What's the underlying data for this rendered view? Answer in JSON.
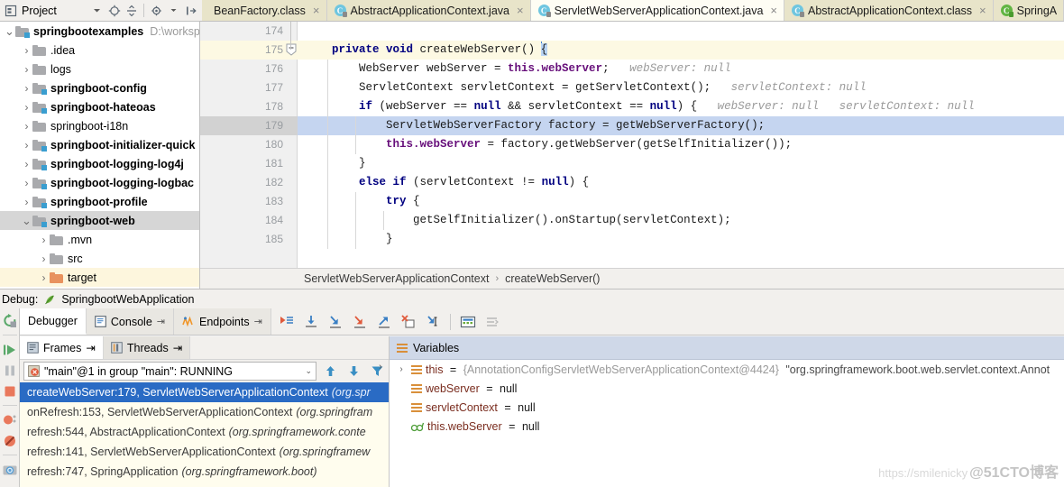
{
  "topbar": {
    "project_label": "Project",
    "icons": [
      "project-dropdown-icon",
      "locate-icon",
      "collapse-all-icon",
      "settings-gear-icon",
      "hide-icon"
    ],
    "tabs": [
      {
        "name": "BeanFactory.class",
        "icon": "class-file-icon",
        "style": "khaki",
        "close": "×"
      },
      {
        "name": "AbstractApplicationContext.java",
        "icon": "java-file-icon",
        "style": "khaki",
        "close": "×"
      },
      {
        "name": "ServletWebServerApplicationContext.java",
        "icon": "java-file-icon",
        "style": "active",
        "close": "×"
      },
      {
        "name": "AbstractApplicationContext.class",
        "icon": "class-file-icon",
        "style": "khaki",
        "close": "×"
      },
      {
        "name": "SpringA",
        "icon": "spring-file-icon",
        "style": "khaki",
        "close": ""
      }
    ]
  },
  "project_tree": [
    {
      "label": "springbootexamples",
      "path": "D:\\worksp",
      "bold": true,
      "indent": 0,
      "arrow": "⌄",
      "folder": "module",
      "state": "normal"
    },
    {
      "label": ".idea",
      "path": "",
      "bold": false,
      "indent": 1,
      "arrow": "›",
      "folder": "plain",
      "state": "normal"
    },
    {
      "label": "logs",
      "path": "",
      "bold": false,
      "indent": 1,
      "arrow": "›",
      "folder": "plain",
      "state": "normal"
    },
    {
      "label": "springboot-config",
      "path": "",
      "bold": true,
      "indent": 1,
      "arrow": "›",
      "folder": "module",
      "state": "normal"
    },
    {
      "label": "springboot-hateoas",
      "path": "",
      "bold": true,
      "indent": 1,
      "arrow": "›",
      "folder": "module",
      "state": "normal"
    },
    {
      "label": "springboot-i18n",
      "path": "",
      "bold": false,
      "indent": 1,
      "arrow": "›",
      "folder": "plain",
      "state": "normal"
    },
    {
      "label": "springboot-initializer-quick",
      "path": "",
      "bold": true,
      "indent": 1,
      "arrow": "›",
      "folder": "module",
      "state": "normal"
    },
    {
      "label": "springboot-logging-log4j",
      "path": "",
      "bold": true,
      "indent": 1,
      "arrow": "›",
      "folder": "module",
      "state": "normal"
    },
    {
      "label": "springboot-logging-logbac",
      "path": "",
      "bold": true,
      "indent": 1,
      "arrow": "›",
      "folder": "module",
      "state": "normal"
    },
    {
      "label": "springboot-profile",
      "path": "",
      "bold": true,
      "indent": 1,
      "arrow": "›",
      "folder": "module",
      "state": "normal"
    },
    {
      "label": "springboot-web",
      "path": "",
      "bold": true,
      "indent": 1,
      "arrow": "⌄",
      "folder": "module",
      "state": "selected"
    },
    {
      "label": ".mvn",
      "path": "",
      "bold": false,
      "indent": 2,
      "arrow": "›",
      "folder": "plain",
      "state": "normal"
    },
    {
      "label": "src",
      "path": "",
      "bold": false,
      "indent": 2,
      "arrow": "›",
      "folder": "plain",
      "state": "normal"
    },
    {
      "label": "target",
      "path": "",
      "bold": false,
      "indent": 2,
      "arrow": "›",
      "folder": "orange",
      "state": "yellow"
    }
  ],
  "editor": {
    "lines": [
      {
        "num": "174",
        "highlight": "none",
        "tokens": []
      },
      {
        "num": "175",
        "highlight": "yellow",
        "fold": true,
        "tokens": [
          {
            "t": "    ",
            "c": "pl"
          },
          {
            "t": "private void ",
            "c": "kw"
          },
          {
            "t": "createWebServer() ",
            "c": "pl"
          },
          {
            "t": "{",
            "c": "pl",
            "sel": true
          }
        ]
      },
      {
        "num": "176",
        "highlight": "none",
        "tokens": [
          {
            "t": "        WebServer webServer = ",
            "c": "pl"
          },
          {
            "t": "this.webServer",
            "c": "fld"
          },
          {
            "t": ";",
            "c": "pl"
          },
          {
            "t": "   webServer: null",
            "c": "hint"
          }
        ]
      },
      {
        "num": "177",
        "highlight": "none",
        "tokens": [
          {
            "t": "        ServletContext servletContext = getServletContext();",
            "c": "pl"
          },
          {
            "t": "   servletContext: null",
            "c": "hint"
          }
        ]
      },
      {
        "num": "178",
        "highlight": "none",
        "tokens": [
          {
            "t": "        ",
            "c": "pl"
          },
          {
            "t": "if",
            "c": "kw"
          },
          {
            "t": " (webServer == ",
            "c": "pl"
          },
          {
            "t": "null",
            "c": "kw"
          },
          {
            "t": " && servletContext == ",
            "c": "pl"
          },
          {
            "t": "null",
            "c": "kw"
          },
          {
            "t": ") {",
            "c": "pl"
          },
          {
            "t": "   webServer: null   servletContext: null",
            "c": "hint"
          }
        ]
      },
      {
        "num": "179",
        "highlight": "blue",
        "tokens": [
          {
            "t": "            ServletWebServerFactory factory = getWebServerFactory();",
            "c": "pl"
          }
        ]
      },
      {
        "num": "180",
        "highlight": "none",
        "tokens": [
          {
            "t": "            ",
            "c": "pl"
          },
          {
            "t": "this.webServer",
            "c": "fld"
          },
          {
            "t": " = factory.getWebServer(getSelfInitializer());",
            "c": "pl"
          }
        ]
      },
      {
        "num": "181",
        "highlight": "none",
        "tokens": [
          {
            "t": "        }",
            "c": "pl"
          }
        ]
      },
      {
        "num": "182",
        "highlight": "none",
        "tokens": [
          {
            "t": "        ",
            "c": "pl"
          },
          {
            "t": "else if",
            "c": "kw"
          },
          {
            "t": " (servletContext != ",
            "c": "pl"
          },
          {
            "t": "null",
            "c": "kw"
          },
          {
            "t": ") {",
            "c": "pl"
          }
        ]
      },
      {
        "num": "183",
        "highlight": "none",
        "tokens": [
          {
            "t": "            ",
            "c": "pl"
          },
          {
            "t": "try",
            "c": "kw"
          },
          {
            "t": " {",
            "c": "pl"
          }
        ]
      },
      {
        "num": "184",
        "highlight": "none",
        "tokens": [
          {
            "t": "                getSelfInitializer().onStartup(servletContext);",
            "c": "pl"
          }
        ]
      },
      {
        "num": "185",
        "highlight": "none",
        "tokens": [
          {
            "t": "            }",
            "c": "pl"
          }
        ]
      }
    ],
    "breadcrumb": {
      "class": "ServletWebServerApplicationContext",
      "separator": "›",
      "method": "createWebServer()"
    }
  },
  "debug": {
    "header_label": "Debug:",
    "config_name": "SpringbootWebApplication",
    "tabs": [
      {
        "label": "Debugger",
        "icon": "debugger-icon",
        "active": true,
        "pin": ""
      },
      {
        "label": "Console",
        "icon": "console-icon",
        "active": false,
        "pin": "⇥"
      },
      {
        "label": "Endpoints",
        "icon": "endpoints-icon",
        "active": false,
        "pin": "⇥"
      }
    ],
    "toolbar_icons": [
      "show-execution-point-icon",
      "step-over-icon",
      "step-into-icon",
      "force-step-into-icon",
      "step-out-icon",
      "drop-frame-icon",
      "run-to-cursor-icon",
      "evaluate-expression-icon",
      "settings-icon"
    ],
    "side_icons": [
      "rerun-icon",
      "resume-program-icon",
      "pause-program-icon",
      "stop-icon",
      "view-breakpoints-icon",
      "mute-breakpoints-icon",
      "settings-camera-icon"
    ]
  },
  "frames": {
    "tabs": [
      {
        "label": "Frames",
        "icon": "frames-icon",
        "active": true,
        "pin": "⇥"
      },
      {
        "label": "Threads",
        "icon": "threads-icon",
        "active": false,
        "pin": "⇥"
      }
    ],
    "thread_selector": {
      "value": "\"main\"@1 in group \"main\": RUNNING",
      "icon": "thread-running-icon",
      "chevron": "⌄"
    },
    "nav_icons": [
      "move-up-icon",
      "move-down-icon",
      "filter-icon"
    ],
    "items": [
      {
        "frame": "createWebServer:179, ServletWebServerApplicationContext",
        "pkg": "(org.spr",
        "selected": true
      },
      {
        "frame": "onRefresh:153, ServletWebServerApplicationContext",
        "pkg": "(org.springfram",
        "selected": false
      },
      {
        "frame": "refresh:544, AbstractApplicationContext",
        "pkg": "(org.springframework.conte",
        "selected": false
      },
      {
        "frame": "refresh:141, ServletWebServerApplicationContext",
        "pkg": "(org.springframew",
        "selected": false
      },
      {
        "frame": "refresh:747, SpringApplication",
        "pkg": "(org.springframework.boot)",
        "selected": false
      }
    ]
  },
  "variables": {
    "title": "Variables",
    "title_icon": "variables-icon",
    "rows": [
      {
        "arrow": "›",
        "icon": "field-icon",
        "name": "this",
        "eq": " = ",
        "value": "{AnnotationConfigServletWebServerApplicationContext@4424} ",
        "value2": "\"org.springframework.boot.web.servlet.context.Annot"
      },
      {
        "arrow": "",
        "icon": "field-icon",
        "name": "webServer",
        "eq": " = ",
        "value": "null",
        "value2": ""
      },
      {
        "arrow": "",
        "icon": "field-icon",
        "name": "servletContext",
        "eq": " = ",
        "value": "null",
        "value2": ""
      },
      {
        "arrow": "",
        "icon": "watch-icon",
        "name": "this.webServer",
        "eq": " = ",
        "value": "null",
        "value2": ""
      }
    ],
    "collapse_arrow": "›"
  },
  "watermark": {
    "url": "https://smilenicky",
    "brand": "@51CTO博客"
  },
  "colors": {
    "accent_blue": "#2a6bc4",
    "exec_line": "#c5d5f0",
    "method_line": "#fdf9e3",
    "keyword": "#000080",
    "field": "#660e7a",
    "hint": "#9a9a9a",
    "frames_bg": "#fffdee",
    "vars_header": "#cfd8e8"
  }
}
